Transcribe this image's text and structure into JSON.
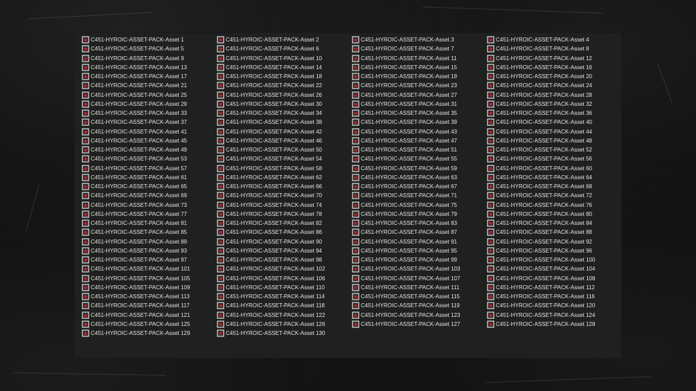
{
  "explorer": {
    "files": [
      "C451-HYROIC-ASSET-PACK-Asset 1",
      "C451-HYROIC-ASSET-PACK-Asset 2",
      "C451-HYROIC-ASSET-PACK-Asset 3",
      "C451-HYROIC-ASSET-PACK-Asset 4",
      "C451-HYROIC-ASSET-PACK-Asset 5",
      "C451-HYROIC-ASSET-PACK-Asset 6",
      "C451-HYROIC-ASSET-PACK-Asset 7",
      "C451-HYROIC-ASSET-PACK-Asset 8",
      "C451-HYROIC-ASSET-PACK-Asset 9",
      "C451-HYROIC-ASSET-PACK-Asset 10",
      "C451-HYROIC-ASSET-PACK-Asset 11",
      "C451-HYROIC-ASSET-PACK-Asset 12",
      "C451-HYROIC-ASSET-PACK-Asset 13",
      "C451-HYROIC-ASSET-PACK-Asset 14",
      "C451-HYROIC-ASSET-PACK-Asset 15",
      "C451-HYROIC-ASSET-PACK-Asset 16",
      "C451-HYROIC-ASSET-PACK-Asset 17",
      "C451-HYROIC-ASSET-PACK-Asset 18",
      "C451-HYROIC-ASSET-PACK-Asset 19",
      "C451-HYROIC-ASSET-PACK-Asset 20",
      "C451-HYROIC-ASSET-PACK-Asset 21",
      "C451-HYROIC-ASSET-PACK-Asset 22",
      "C451-HYROIC-ASSET-PACK-Asset 23",
      "C451-HYROIC-ASSET-PACK-Asset 24",
      "C451-HYROIC-ASSET-PACK-Asset 25",
      "C451-HYROIC-ASSET-PACK-Asset 26",
      "C451-HYROIC-ASSET-PACK-Asset 27",
      "C451-HYROIC-ASSET-PACK-Asset 28",
      "C451-HYROIC-ASSET-PACK-Asset 29",
      "C451-HYROIC-ASSET-PACK-Asset 30",
      "C451-HYROIC-ASSET-PACK-Asset 31",
      "C451-HYROIC-ASSET-PACK-Asset 32",
      "C451-HYROIC-ASSET-PACK-Asset 33",
      "C451-HYROIC-ASSET-PACK-Asset 34",
      "C451-HYROIC-ASSET-PACK-Asset 35",
      "C451-HYROIC-ASSET-PACK-Asset 36",
      "C451-HYROIC-ASSET-PACK-Asset 37",
      "C451-HYROIC-ASSET-PACK-Asset 38",
      "C451-HYROIC-ASSET-PACK-Asset 39",
      "C451-HYROIC-ASSET-PACK-Asset 40",
      "C451-HYROIC-ASSET-PACK-Asset 41",
      "C451-HYROIC-ASSET-PACK-Asset 42",
      "C451-HYROIC-ASSET-PACK-Asset 43",
      "C451-HYROIC-ASSET-PACK-Asset 44",
      "C451-HYROIC-ASSET-PACK-Asset 45",
      "C451-HYROIC-ASSET-PACK-Asset 46",
      "C451-HYROIC-ASSET-PACK-Asset 47",
      "C451-HYROIC-ASSET-PACK-Asset 48",
      "C451-HYROIC-ASSET-PACK-Asset 49",
      "C451-HYROIC-ASSET-PACK-Asset 50",
      "C451-HYROIC-ASSET-PACK-Asset 51",
      "C451-HYROIC-ASSET-PACK-Asset 52",
      "C451-HYROIC-ASSET-PACK-Asset 53",
      "C451-HYROIC-ASSET-PACK-Asset 54",
      "C451-HYROIC-ASSET-PACK-Asset 55",
      "C451-HYROIC-ASSET-PACK-Asset 56",
      "C451-HYROIC-ASSET-PACK-Asset 57",
      "C451-HYROIC-ASSET-PACK-Asset 58",
      "C451-HYROIC-ASSET-PACK-Asset 59",
      "C451-HYROIC-ASSET-PACK-Asset 60",
      "C451-HYROIC-ASSET-PACK-Asset 61",
      "C451-HYROIC-ASSET-PACK-Asset 62",
      "C451-HYROIC-ASSET-PACK-Asset 63",
      "C451-HYROIC-ASSET-PACK-Asset 64",
      "C451-HYROIC-ASSET-PACK-Asset 65",
      "C451-HYROIC-ASSET-PACK-Asset 66",
      "C451-HYROIC-ASSET-PACK-Asset 67",
      "C451-HYROIC-ASSET-PACK-Asset 68",
      "C451-HYROIC-ASSET-PACK-Asset 69",
      "C451-HYROIC-ASSET-PACK-Asset 70",
      "C451-HYROIC-ASSET-PACK-Asset 71",
      "C451-HYROIC-ASSET-PACK-Asset 72",
      "C451-HYROIC-ASSET-PACK-Asset 73",
      "C451-HYROIC-ASSET-PACK-Asset 74",
      "C451-HYROIC-ASSET-PACK-Asset 75",
      "C451-HYROIC-ASSET-PACK-Asset 76",
      "C451-HYROIC-ASSET-PACK-Asset 77",
      "C451-HYROIC-ASSET-PACK-Asset 78",
      "C451-HYROIC-ASSET-PACK-Asset 79",
      "C451-HYROIC-ASSET-PACK-Asset 80",
      "C451-HYROIC-ASSET-PACK-Asset 81",
      "C451-HYROIC-ASSET-PACK-Asset 82",
      "C451-HYROIC-ASSET-PACK-Asset 83",
      "C451-HYROIC-ASSET-PACK-Asset 84",
      "C451-HYROIC-ASSET-PACK-Asset 85",
      "C451-HYROIC-ASSET-PACK-Asset 86",
      "C451-HYROIC-ASSET-PACK-Asset 87",
      "C451-HYROIC-ASSET-PACK-Asset 88",
      "C451-HYROIC-ASSET-PACK-Asset 89",
      "C451-HYROIC-ASSET-PACK-Asset 90",
      "C451-HYROIC-ASSET-PACK-Asset 91",
      "C451-HYROIC-ASSET-PACK-Asset 92",
      "C451-HYROIC-ASSET-PACK-Asset 93",
      "C451-HYROIC-ASSET-PACK-Asset 94",
      "C451-HYROIC-ASSET-PACK-Asset 95",
      "C451-HYROIC-ASSET-PACK-Asset 96",
      "C451-HYROIC-ASSET-PACK-Asset 97",
      "C451-HYROIC-ASSET-PACK-Asset 98",
      "C451-HYROIC-ASSET-PACK-Asset 99",
      "C451-HYROIC-ASSET-PACK-Asset 100",
      "C451-HYROIC-ASSET-PACK-Asset 101",
      "C451-HYROIC-ASSET-PACK-Asset 102",
      "C451-HYROIC-ASSET-PACK-Asset 103",
      "C451-HYROIC-ASSET-PACK-Asset 104",
      "C451-HYROIC-ASSET-PACK-Asset 105",
      "C451-HYROIC-ASSET-PACK-Asset 106",
      "C451-HYROIC-ASSET-PACK-Asset 107",
      "C451-HYROIC-ASSET-PACK-Asset 108",
      "C451-HYROIC-ASSET-PACK-Asset 109",
      "C451-HYROIC-ASSET-PACK-Asset 110",
      "C451-HYROIC-ASSET-PACK-Asset 111",
      "C451-HYROIC-ASSET-PACK-Asset 112",
      "C451-HYROIC-ASSET-PACK-Asset 113",
      "C451-HYROIC-ASSET-PACK-Asset 114",
      "C451-HYROIC-ASSET-PACK-Asset 115",
      "C451-HYROIC-ASSET-PACK-Asset 116",
      "C451-HYROIC-ASSET-PACK-Asset 117",
      "C451-HYROIC-ASSET-PACK-Asset 118",
      "C451-HYROIC-ASSET-PACK-Asset 119",
      "C451-HYROIC-ASSET-PACK-Asset 120",
      "C451-HYROIC-ASSET-PACK-Asset 121",
      "C451-HYROIC-ASSET-PACK-Asset 122",
      "C451-HYROIC-ASSET-PACK-Asset 123",
      "C451-HYROIC-ASSET-PACK-Asset 124",
      "C451-HYROIC-ASSET-PACK-Asset 125",
      "C451-HYROIC-ASSET-PACK-Asset 126",
      "C451-HYROIC-ASSET-PACK-Asset 127",
      "C451-HYROIC-ASSET-PACK-Asset 128",
      "C451-HYROIC-ASSET-PACK-Asset 129",
      "C451-HYROIC-ASSET-PACK-Asset 130"
    ],
    "file_icon": "image-file-icon"
  },
  "colors": {
    "backdrop": "#0d0d0d",
    "panel": "#202020",
    "text": "#e4e4e4",
    "icon_accent": "#d21f2b"
  }
}
